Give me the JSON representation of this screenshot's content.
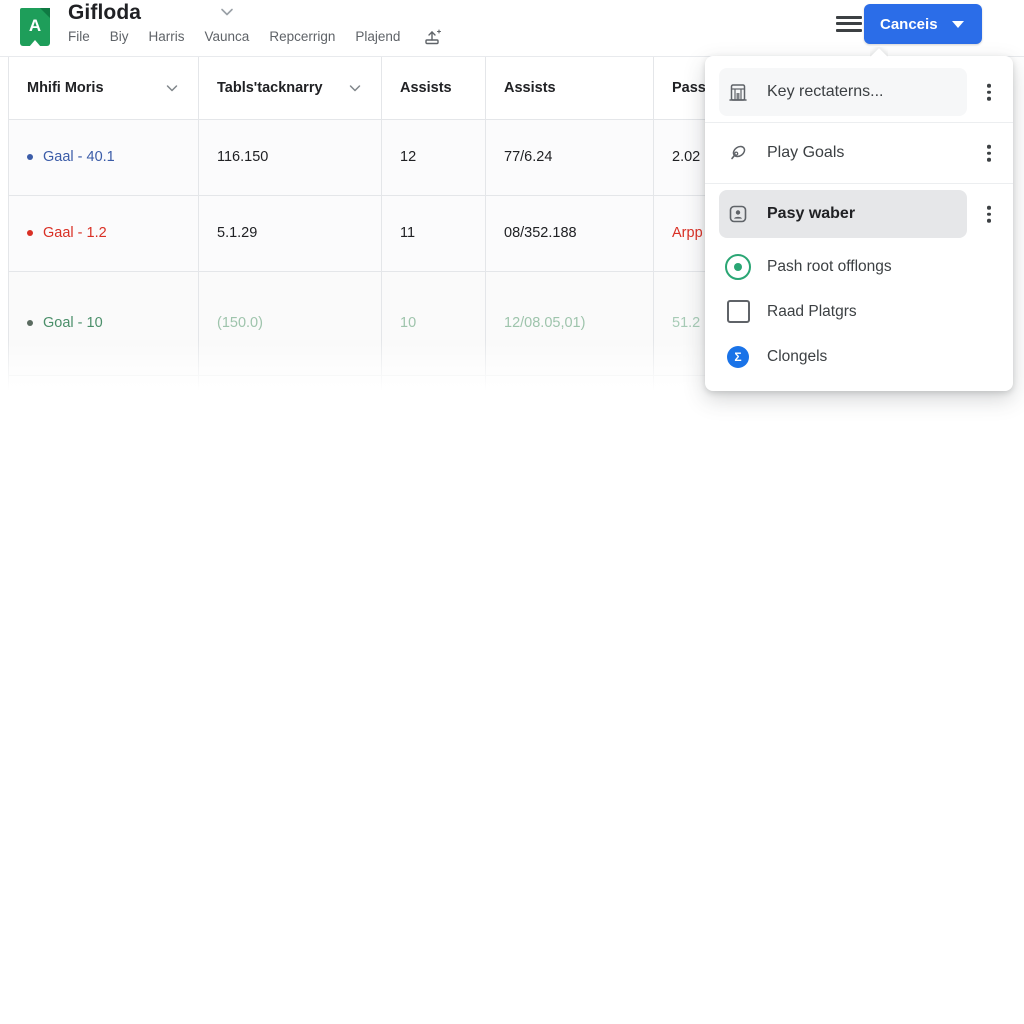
{
  "app": {
    "logo_letter": "A",
    "title": "Gifloda",
    "title_chevron_icon": "chevron-down-icon"
  },
  "menubar": {
    "items": [
      {
        "label": "File"
      },
      {
        "label": "Biy"
      },
      {
        "label": "Harris"
      },
      {
        "label": "Vaunca"
      },
      {
        "label": "Repcerrign"
      },
      {
        "label": "Plajend"
      }
    ],
    "trailing_icon": "slide-upload-icon"
  },
  "toolbar": {
    "hamburger_icon": "hamburger-menu-icon",
    "primary_button": {
      "label": "Canceis",
      "caret_icon": "caret-down-icon",
      "color": "#2b6de8"
    }
  },
  "table": {
    "columns": [
      {
        "label": "Mhifi Moris",
        "has_chevron": true
      },
      {
        "label": "Tabls'tacknarry",
        "has_chevron": true
      },
      {
        "label": "Assists",
        "has_chevron": false
      },
      {
        "label": "Assists",
        "has_chevron": false
      },
      {
        "label": "Passe",
        "has_chevron": false
      }
    ],
    "rows": [
      {
        "tone": "blue",
        "dot_color": "#3b5ca8",
        "label": "Gaal - 40.1",
        "cells": [
          "116.150",
          "12",
          "77/6.24",
          "2.02"
        ]
      },
      {
        "tone": "red",
        "dot_color": "#d93025",
        "label": "Gaal - 1.2",
        "cells": [
          "5.1.29",
          "11",
          "08/352.188",
          "Arpp"
        ]
      },
      {
        "tone": "green",
        "dot_color": "#5a6b60",
        "label": "Goal - 10",
        "cells": [
          "(150.0)",
          "10",
          "12/08.05,01)",
          "51.2"
        ]
      }
    ]
  },
  "popover": {
    "items": [
      {
        "label": "Key rectaterns...",
        "icon": "building-icon",
        "kebab": true,
        "highlight": "soft",
        "divider": true
      },
      {
        "label": "Play Goals",
        "icon": "tag-icon",
        "kebab": true,
        "highlight": "none",
        "divider": true
      },
      {
        "label": "Pasy waber",
        "icon": "id-card-icon",
        "kebab": true,
        "highlight": "strong",
        "divider": false
      },
      {
        "label": "Pash root offlongs",
        "icon": "circle-plus-icon",
        "kebab": false,
        "highlight": "none",
        "divider": false
      },
      {
        "label": "Raad Platgrs",
        "icon": "checkbox-icon",
        "kebab": false,
        "highlight": "none",
        "divider": false
      },
      {
        "label": "Clongels",
        "icon": "blue-badge-icon",
        "kebab": false,
        "highlight": "none",
        "divider": false
      }
    ]
  }
}
